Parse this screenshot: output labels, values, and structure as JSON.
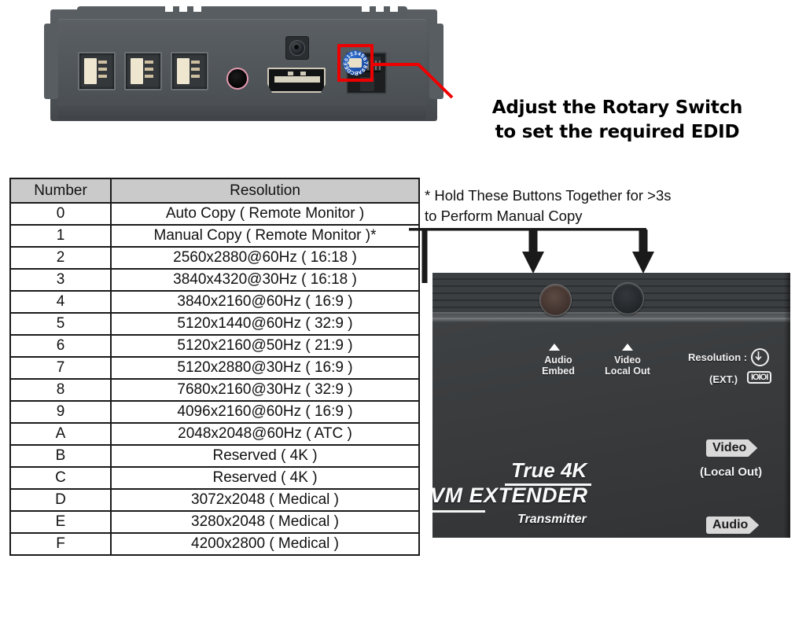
{
  "rear_panel": {
    "ports": [
      {
        "name": "usb-port-1",
        "type": "USB"
      },
      {
        "name": "usb-port-2",
        "type": "USB"
      },
      {
        "name": "usb-port-3",
        "type": "USB"
      },
      {
        "name": "audio-jack",
        "type": "Audio"
      },
      {
        "name": "dc-power-jack",
        "type": "DC"
      },
      {
        "name": "hdmi-port",
        "type": "HDMI"
      },
      {
        "name": "rj45-port",
        "type": "RJ45"
      }
    ],
    "rotary_switch": {
      "label": "rotary-switch",
      "characters": [
        "0",
        "1",
        "2",
        "3",
        "4",
        "5",
        "6",
        "7",
        "8",
        "9",
        "A",
        "B",
        "C",
        "D",
        "E",
        "F"
      ],
      "highlight_color": "#ee0000",
      "dial_color": "#1f53ae"
    }
  },
  "callout": {
    "heading": "Adjust the Rotary Switch\nto set the required EDID",
    "line_color": "#ee0000"
  },
  "table": {
    "headers": [
      "Number",
      "Resolution"
    ],
    "rows": [
      [
        "0",
        "Auto Copy ( Remote Monitor )"
      ],
      [
        "1",
        "Manual Copy ( Remote Monitor )*"
      ],
      [
        "2",
        "2560x2880@60Hz ( 16:18 )"
      ],
      [
        "3",
        "3840x4320@30Hz ( 16:18 )"
      ],
      [
        "4",
        "3840x2160@60Hz ( 16:9 )"
      ],
      [
        "5",
        "5120x1440@60Hz ( 32:9 )"
      ],
      [
        "6",
        "5120x2160@50Hz ( 21:9 )"
      ],
      [
        "7",
        "5120x2880@30Hz ( 16:9 )"
      ],
      [
        "8",
        "7680x2160@30Hz ( 32:9 )"
      ],
      [
        "9",
        "4096x2160@60Hz ( 16:9 )"
      ],
      [
        "A",
        "2048x2048@60Hz ( ATC )"
      ],
      [
        "B",
        "Reserved ( 4K )"
      ],
      [
        "C",
        "Reserved ( 4K )"
      ],
      [
        "D",
        "3072x2048 ( Medical )"
      ],
      [
        "E",
        "3280x2048 ( Medical )"
      ],
      [
        "F",
        "4200x2800 ( Medical )"
      ]
    ],
    "header_bg": "#cacaca"
  },
  "note": {
    "text": "* Hold These Buttons Together for >3s\n   to Perform Manual Copy"
  },
  "transmitter": {
    "buttons": [
      {
        "name": "audio-embed-button",
        "label": "Audio\nEmbed"
      },
      {
        "name": "video-local-out-button",
        "label": "Video\nLocal Out"
      }
    ],
    "resolution_label": "Resolution :",
    "ext_label": "(EXT.)",
    "ext_icon_text": "IOIOI",
    "brand_true4k": "True 4K",
    "brand_extender": "VM EXTENDER",
    "brand_role": "Transmitter",
    "video_tag": "Video",
    "video_tag_sub": "(Local Out)",
    "audio_tag": "Audio"
  }
}
